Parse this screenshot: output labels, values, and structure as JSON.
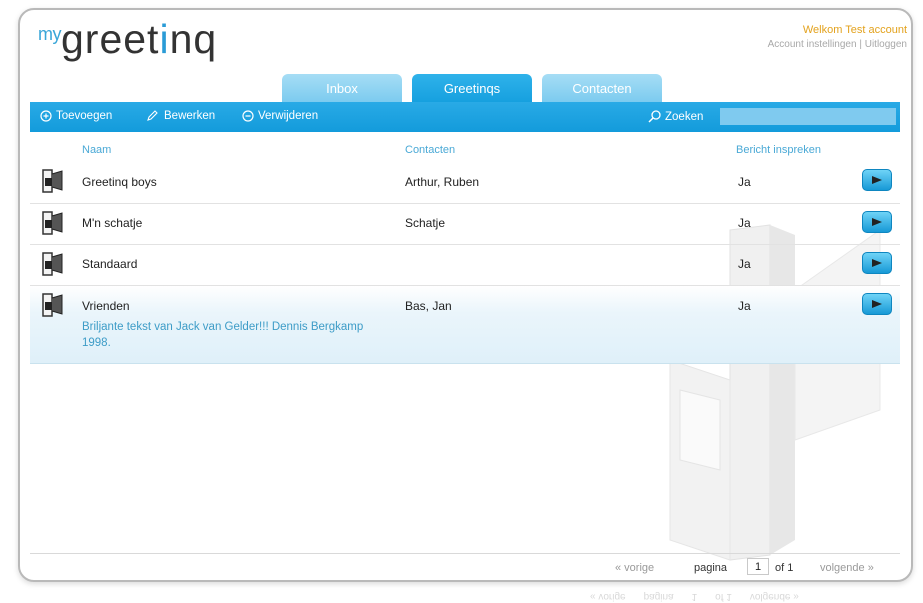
{
  "header": {
    "logo_prefix": "my",
    "logo_main": "greet",
    "logo_accent": "i",
    "logo_suffix": "nq",
    "welcome": "Welkom Test account",
    "account_settings": "Account instellingen",
    "separator": "|",
    "logout": "Uitloggen"
  },
  "tabs": [
    {
      "label": "Inbox",
      "active": false
    },
    {
      "label": "Greetinqs",
      "active": true
    },
    {
      "label": "Contacten",
      "active": false
    }
  ],
  "toolbar": {
    "add_label": "Toevoegen",
    "edit_label": "Bewerken",
    "delete_label": "Verwijderen",
    "search_label": "Zoeken",
    "search_value": ""
  },
  "table": {
    "columns": [
      "Naam",
      "Contacten",
      "Bericht inspreken"
    ],
    "rows": [
      {
        "name": "Greetinq boys",
        "contacts": "Arthur, Ruben",
        "message": "Ja",
        "description": ""
      },
      {
        "name": "M'n schatje",
        "contacts": "Schatje",
        "message": "Ja",
        "description": ""
      },
      {
        "name": "Standaard",
        "contacts": "",
        "message": "Ja",
        "description": ""
      },
      {
        "name": "Vrienden",
        "contacts": "Bas, Jan",
        "message": "Ja",
        "description": "Briljante tekst van Jack van Gelder!!! Dennis Bergkamp 1998."
      }
    ],
    "selected_row": 3
  },
  "pagination": {
    "prev": "« vorige",
    "page_label": "pagina",
    "page_value": "1",
    "of_label": "of 1",
    "next": "volgende »"
  },
  "colors": {
    "accent": "#1aa2df",
    "logo_accent": "#2a9bd6",
    "welcome": "#e3a21d"
  }
}
